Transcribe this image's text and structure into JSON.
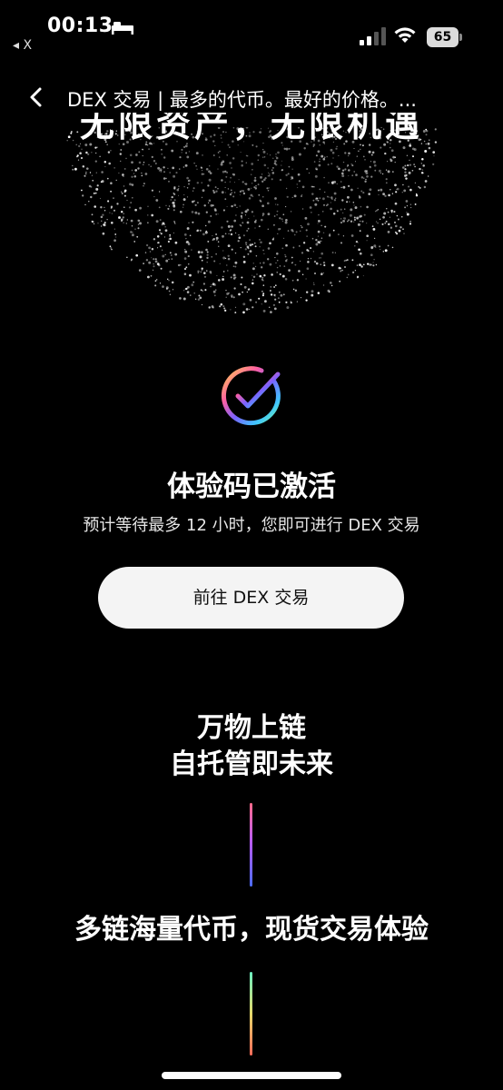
{
  "status_bar": {
    "time": "00:13",
    "back_app": "◂ X",
    "battery": "65"
  },
  "nav": {
    "title": "DEX 交易 | 最多的代币。最好的价格。..."
  },
  "hero": {
    "title": "无限资产，无限机遇"
  },
  "activation": {
    "title": "体验码已激活",
    "subtitle": "预计等待最多 12 小时，您即可进行 DEX 交易",
    "button_label": "前往 DEX 交易"
  },
  "sections": {
    "line1": "万物上链",
    "line2": "自托管即未来",
    "line3": "多链海量代币，现货交易体验"
  },
  "colors": {
    "background": "#000000",
    "button_bg": "#f4f4f4",
    "button_text": "#111111"
  }
}
